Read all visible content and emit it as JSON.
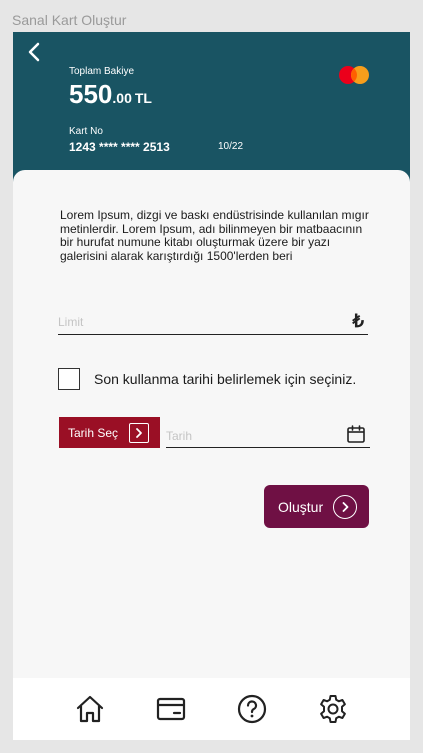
{
  "window": {
    "title": "Sanal Kart Oluştur"
  },
  "card": {
    "balance_label": "Toplam Bakiye",
    "balance_int": "550",
    "balance_dec": ".00",
    "currency": "TL",
    "card_no_label": "Kart No",
    "card_no": "1243 **** **** 2513",
    "expiry": "10/22",
    "background": "#195463"
  },
  "form": {
    "description": "Lorem Ipsum, dizgi ve baskı endüstrisinde kullanılan mıgır metinlerdir. Lorem Ipsum, adı bilinmeyen bir matbaacının bir hurufat numune kitabı oluşturmak üzere bir yazı galerisini alarak karıştırdığı 1500'lerden beri",
    "limit_placeholder": "Limit",
    "limit_value": "",
    "currency_symbol": "₺",
    "checkbox_label": "Son kullanma tarihi belirlemek için seçiniz.",
    "checkbox_checked": false,
    "date_button_label": "Tarih Seç",
    "date_placeholder": "Tarih",
    "date_value": "",
    "create_button_label": "Oluştur"
  },
  "nav": {
    "items": [
      {
        "icon": "home-icon"
      },
      {
        "icon": "wallet-icon"
      },
      {
        "icon": "help-icon"
      },
      {
        "icon": "gear-icon"
      }
    ]
  },
  "colors": {
    "header": "#195463",
    "date_button": "#9a0f25",
    "create_button": "#6f1044"
  }
}
